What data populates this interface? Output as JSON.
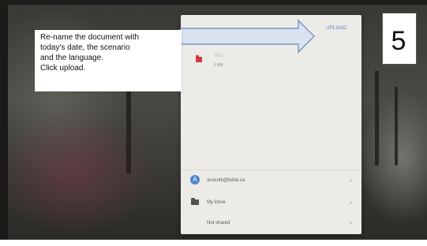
{
  "callout": {
    "lines": [
      "Re-name the document with",
      "today's date, the scenario",
      "and the language.",
      "Click upload."
    ]
  },
  "step": {
    "number": "5"
  },
  "dialog": {
    "upload_label": "UPLOAD",
    "file": {
      "name": "Text",
      "size": "3 MB",
      "icon": "file-icon"
    },
    "account": {
      "email": "arsicoth@hdsb.ca",
      "avatar_letter": "A",
      "icon": "avatar"
    },
    "folder": {
      "label": "My Drive",
      "icon": "folder-icon"
    },
    "sharing": {
      "label": "Not shared"
    },
    "chevron": "›"
  },
  "colors": {
    "upload_accent": "#5a7fc0",
    "file_icon": "#d03a3a",
    "avatar": "#4e86c9",
    "arrow_fill": "#d9e3f0",
    "arrow_stroke": "#6a86b8"
  }
}
